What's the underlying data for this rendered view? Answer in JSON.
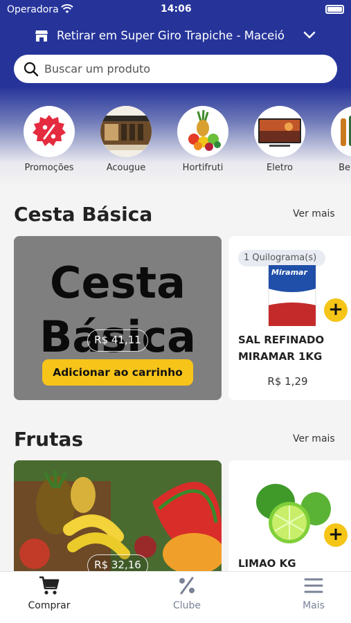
{
  "status_bar": {
    "carrier": "Operadora",
    "time": "14:06"
  },
  "header": {
    "pickup_label": "Retirar em Super Giro Trapiche - Maceió",
    "search_placeholder": "Buscar um produto"
  },
  "categories": [
    {
      "label": "Promoções",
      "icon": "percent-badge-icon"
    },
    {
      "label": "Acougue",
      "icon": "butcher-shop-image"
    },
    {
      "label": "Hortifruti",
      "icon": "fruits-vegetables-image"
    },
    {
      "label": "Eletro",
      "icon": "television-image"
    },
    {
      "label": "Bebidas",
      "icon": "bottles-image"
    }
  ],
  "sections": [
    {
      "title": "Cesta Básica",
      "see_more": "Ver mais",
      "banner": {
        "text_line1": "Cesta",
        "text_line2": "Básica",
        "price": "R$ 41,11",
        "button": "Adicionar ao carrinho"
      },
      "product": {
        "qty_tag": "1 Quilograma(s)",
        "brand": "Miramar",
        "name": "SAL REFINADO MIRAMAR 1KG",
        "price": "R$ 1,29"
      }
    },
    {
      "title": "Frutas",
      "see_more": "Ver mais",
      "banner": {
        "price": "R$ 32,16"
      },
      "product": {
        "name": "LIMAO KG"
      }
    }
  ],
  "tabs": [
    {
      "label": "Comprar",
      "icon": "cart-icon",
      "active": true
    },
    {
      "label": "Clube",
      "icon": "percent-icon",
      "active": false
    },
    {
      "label": "Mais",
      "icon": "menu-icon",
      "active": false
    }
  ],
  "colors": {
    "header_blue": "#26349a",
    "accent_yellow": "#f5c518",
    "tab_active": "#222222",
    "tab_inactive": "#7a8296"
  }
}
